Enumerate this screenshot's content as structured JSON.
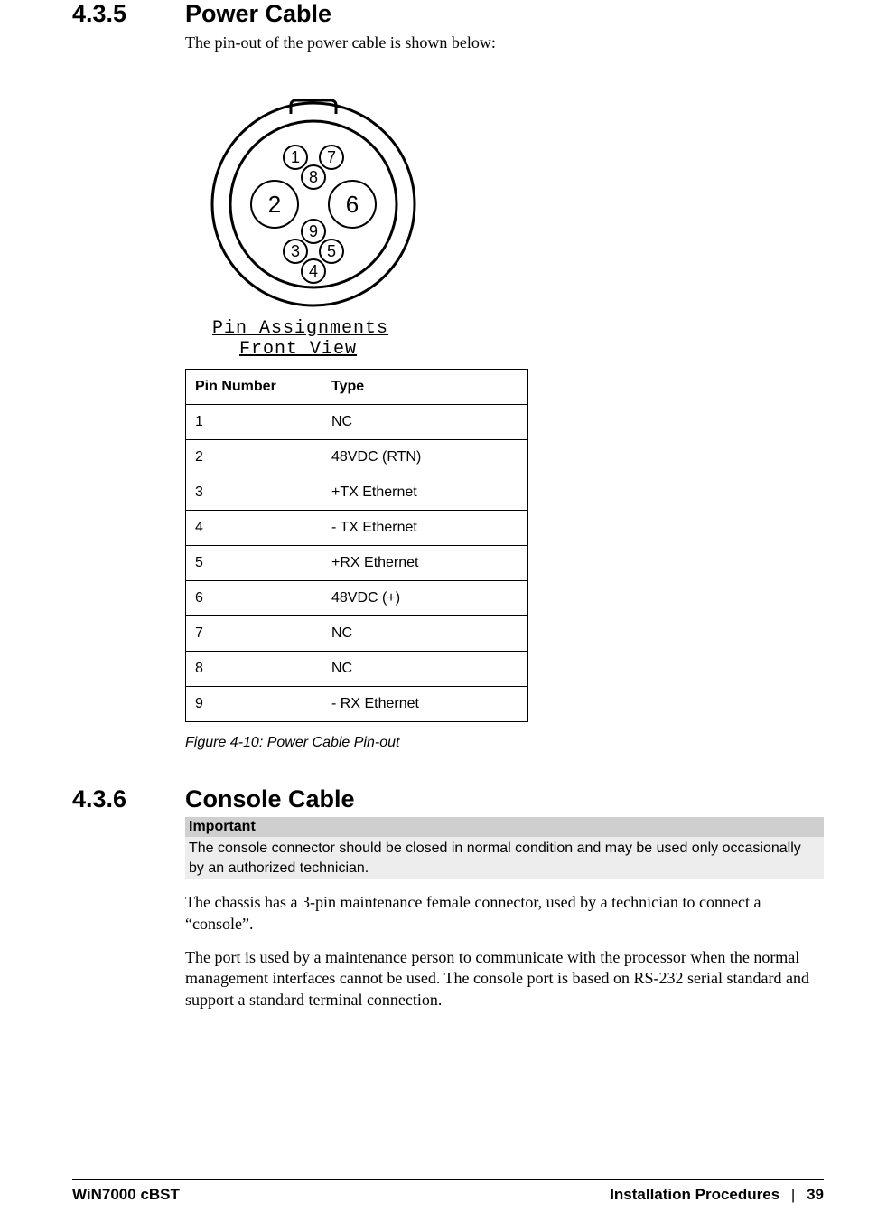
{
  "section1": {
    "number": "4.3.5",
    "title": "Power Cable",
    "intro": "The pin-out of the power cable is shown below:",
    "diagram": {
      "pins": [
        "1",
        "2",
        "3",
        "4",
        "5",
        "6",
        "7",
        "8",
        "9"
      ],
      "label1": "Pin  Assignments",
      "label2": "Front  View"
    },
    "table": {
      "headers": [
        "Pin Number",
        "Type"
      ],
      "rows": [
        {
          "pin": "1",
          "type": "NC"
        },
        {
          "pin": "2",
          "type": "48VDC (RTN)"
        },
        {
          "pin": "3",
          "type": "+TX Ethernet"
        },
        {
          "pin": "4",
          "type": "- TX Ethernet"
        },
        {
          "pin": "5",
          "type": "+RX Ethernet"
        },
        {
          "pin": "6",
          "type": "48VDC (+)"
        },
        {
          "pin": "7",
          "type": "NC"
        },
        {
          "pin": "8",
          "type": "NC"
        },
        {
          "pin": "9",
          "type": "- RX Ethernet"
        }
      ]
    },
    "caption": "Figure 4-10: Power Cable Pin-out"
  },
  "section2": {
    "number": "4.3.6",
    "title": "Console Cable",
    "callout_head": "Important",
    "callout_body": "The console connector should be closed in normal condition and may be used only occasionally by an authorized technician.",
    "para1": "The chassis has a 3-pin maintenance female connector, used by a technician to connect a “console”.",
    "para2": "The port is used by a maintenance person to communicate with the processor when the normal management interfaces cannot be used. The console port is based on RS-232 serial standard and support a standard terminal connection."
  },
  "footer": {
    "left": "WiN7000 cBST",
    "right_a": "Installation Procedures",
    "sep": "|",
    "page": "39"
  }
}
